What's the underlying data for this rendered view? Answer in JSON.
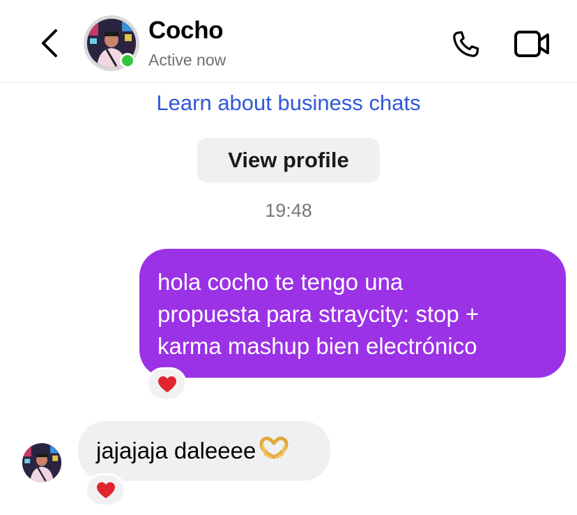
{
  "header": {
    "contact_name": "Cocho",
    "status": "Active now",
    "online_color": "#31c73b"
  },
  "chat": {
    "learn_link": "Learn about business chats",
    "view_profile_label": "View profile",
    "timestamp": "19:48",
    "messages": [
      {
        "direction": "outgoing",
        "text": "hola cocho te tengo una\npropuesta para straycity: stop +\nkarma mashup bien electrónico",
        "reaction": "heart"
      },
      {
        "direction": "incoming",
        "text": "jajajaja daleeee",
        "trailing_emoji": "heart-hands",
        "reaction": "heart"
      }
    ]
  },
  "colors": {
    "outgoing_bubble": "#9b32e6",
    "incoming_bubble": "#eff0f2",
    "link": "#2f57d6"
  }
}
